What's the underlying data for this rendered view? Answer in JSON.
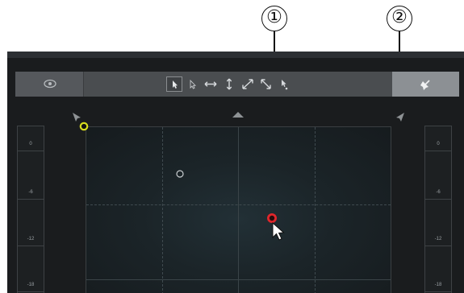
{
  "callouts": [
    {
      "label": "①"
    },
    {
      "label": "②"
    }
  ],
  "toolbar": {
    "eye_icon": "eye-icon",
    "tools": [
      "select-tool",
      "select-outline-tool",
      "horizontal-move-tool",
      "vertical-move-tool",
      "diagonal-up-tool",
      "diagonal-down-tool",
      "point-tool"
    ],
    "right_icon": "pin-icon"
  },
  "meters": {
    "left": [
      "0",
      "-6",
      "-12",
      "-18"
    ],
    "right": [
      "0",
      "-6",
      "-12",
      "-18"
    ]
  },
  "colors": {
    "yellow_point": "#d6dc1e",
    "red_point": "#e0262b",
    "panel": "#1a1c1e",
    "toolbar": "#4a4d50"
  }
}
